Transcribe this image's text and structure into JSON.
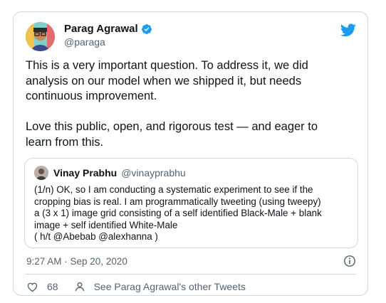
{
  "author": {
    "name": "Parag Agrawal",
    "handle": "@paraga"
  },
  "tweet": {
    "text": "This is a very important question. To address it, we did\nanalysis on our model when we shipped it, but needs\ncontinuous improvement.\n\nLove this public, open, and rigorous test — and eager to\nlearn from this."
  },
  "quoted": {
    "name": "Vinay Prabhu",
    "handle": "@vinayprabhu",
    "text": "(1/n) OK, so I am conducting a systematic experiment to see if the\ncropping bias is real. I am programmatically tweeting (using tweepy)\na (3 x 1) image grid consisting of a self identified Black-Male + blank\nimage + self identified White-Male\n( h/t @Abebab @alexhanna )"
  },
  "meta": {
    "timestamp": "9:27 AM · Sep 20, 2020"
  },
  "actions": {
    "like_count": "68",
    "other_tweets_label": "See Parag Agrawal's other Tweets"
  },
  "colors": {
    "brand_blue": "#1d9bf0",
    "text_primary": "#0f1419",
    "text_secondary": "#536471",
    "border": "#cfd9de"
  },
  "icons": [
    "verified-badge-icon",
    "twitter-bird-icon",
    "info-icon",
    "heart-icon",
    "person-icon"
  ]
}
